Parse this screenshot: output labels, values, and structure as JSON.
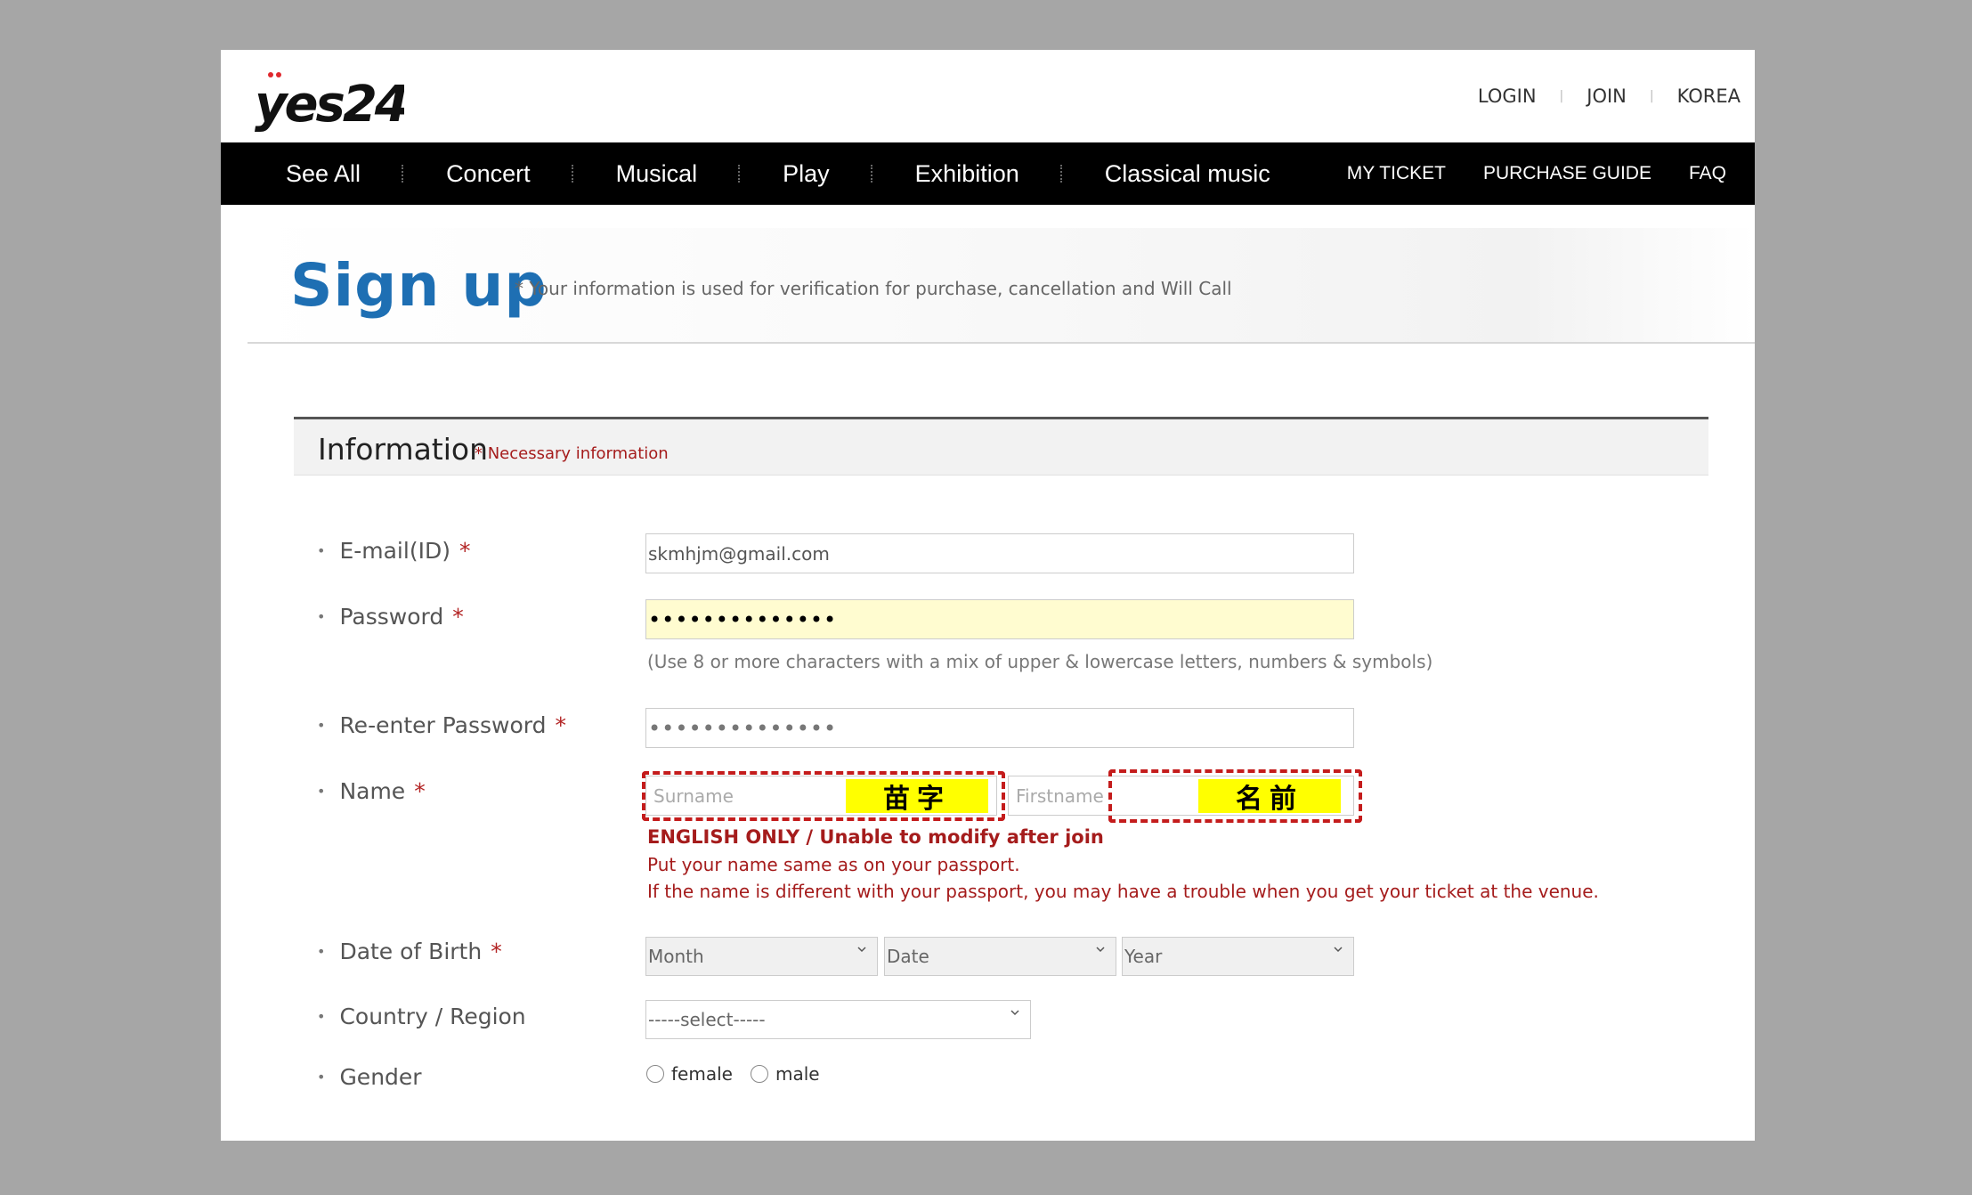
{
  "header": {
    "logo_text": "yes24",
    "links": [
      "LOGIN",
      "JOIN",
      "KOREA"
    ]
  },
  "nav": {
    "left": [
      "See All",
      "Concert",
      "Musical",
      "Play",
      "Exhibition",
      "Classical music"
    ],
    "right": [
      "MY TICKET",
      "PURCHASE GUIDE",
      "FAQ"
    ]
  },
  "title": {
    "heading": "Sign up",
    "note": "* Your information is used for verification for purchase, cancellation and Will Call"
  },
  "section": {
    "title": "Information",
    "required_note": "* Necessary information"
  },
  "form": {
    "email": {
      "label": "E-mail(ID)",
      "star": "*",
      "value": "skmhjm@gmail.com"
    },
    "password": {
      "label": "Password",
      "star": "*",
      "value": "••••••••••••••",
      "hint": "(Use 8 or more characters with a mix of upper & lowercase letters, numbers & symbols)"
    },
    "repassword": {
      "label": "Re-enter Password",
      "star": "*",
      "value": "••••••••••••••"
    },
    "name": {
      "label": "Name",
      "star": "*",
      "surname_placeholder": "Surname",
      "firstname_placeholder": "Firstname",
      "surname_annotation": "苗字",
      "firstname_annotation": "名前",
      "warning_bold": "ENGLISH ONLY / Unable to modify after join",
      "warning_line1": "Put your name same as on your passport.",
      "warning_line2": "If the name is different with your passport, you may have a trouble when you get your ticket at the venue."
    },
    "dob": {
      "label": "Date of Birth",
      "star": "*",
      "month": "Month",
      "date": "Date",
      "year": "Year"
    },
    "country": {
      "label": "Country / Region",
      "value": "-----select-----"
    },
    "gender": {
      "label": "Gender",
      "options": [
        "female",
        "male"
      ]
    }
  },
  "colors": {
    "accent_blue": "#1e6fb3",
    "required_red": "#a51c1c",
    "annotation_yellow": "#ffff00",
    "nav_bg": "#000000"
  }
}
